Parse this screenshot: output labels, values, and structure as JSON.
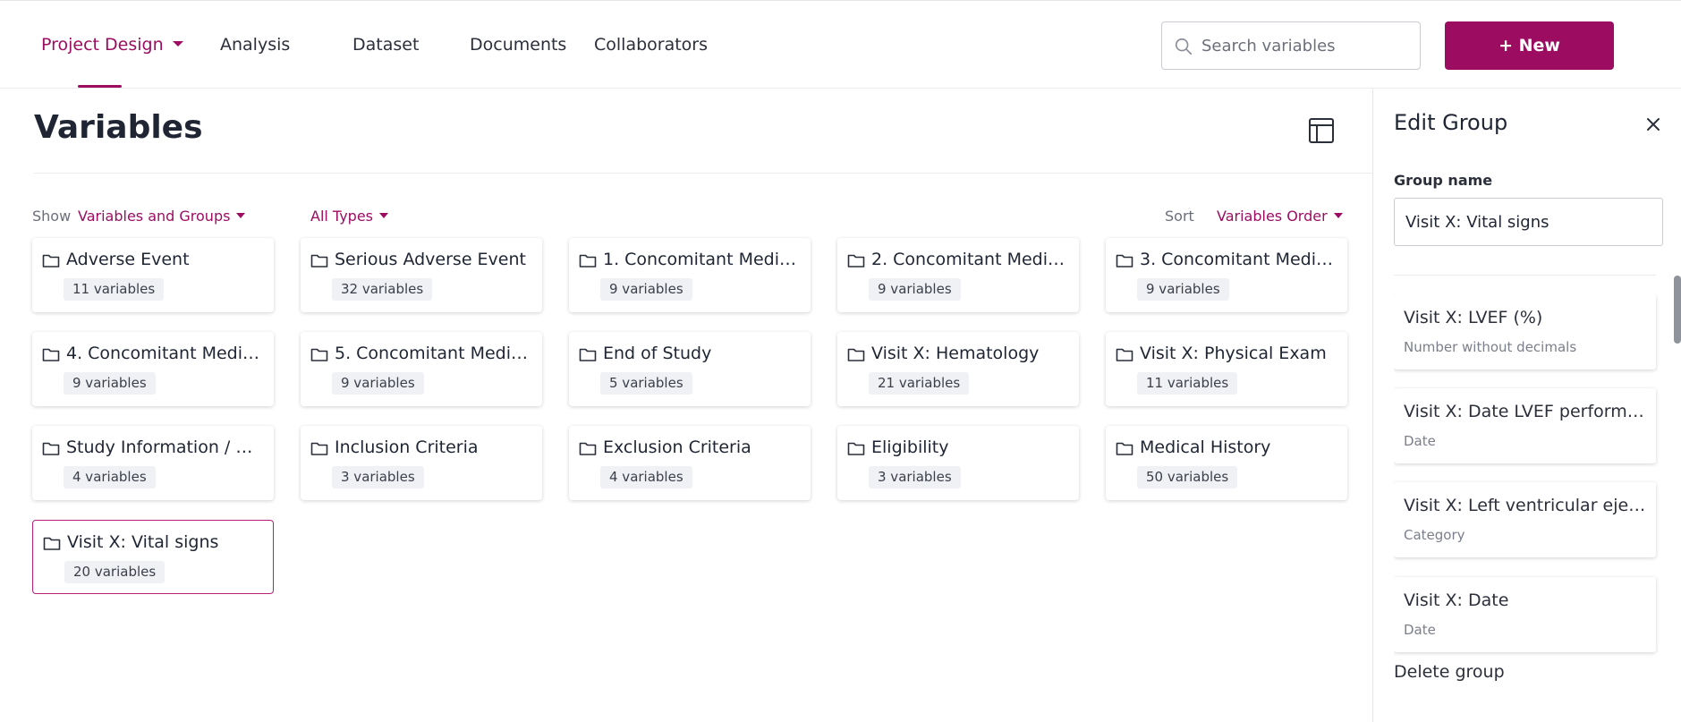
{
  "nav": {
    "items": [
      {
        "label": "Project Design",
        "active": true
      },
      {
        "label": "Analysis"
      },
      {
        "label": "Dataset"
      },
      {
        "label": "Documents"
      },
      {
        "label": "Collaborators"
      }
    ],
    "search_placeholder": "Search variables",
    "new_button": "+ New"
  },
  "main": {
    "title": "Variables",
    "filters": {
      "show_label": "Show",
      "show_value": "Variables and Groups",
      "types_value": "All Types",
      "sort_label": "Sort",
      "sort_value": "Variables Order"
    },
    "groups": [
      {
        "name": "Adverse Event",
        "count": "11 variables"
      },
      {
        "name": "Serious Adverse Event",
        "count": "32 variables"
      },
      {
        "name": "1. Concomitant Medic...",
        "count": "9 variables"
      },
      {
        "name": "2. Concomitant Medic...",
        "count": "9 variables"
      },
      {
        "name": "3. Concomitant Medic...",
        "count": "9 variables"
      },
      {
        "name": "4. Concomitant Medic...",
        "count": "9 variables"
      },
      {
        "name": "5. Concomitant Medic...",
        "count": "9 variables"
      },
      {
        "name": "End of Study",
        "count": "5 variables"
      },
      {
        "name": "Visit X: Hematology",
        "count": "21 variables"
      },
      {
        "name": "Visit X: Physical Exam",
        "count": "11 variables"
      },
      {
        "name": "Study Information / D...",
        "count": "4 variables"
      },
      {
        "name": "Inclusion Criteria",
        "count": "3 variables"
      },
      {
        "name": "Exclusion Criteria",
        "count": "4 variables"
      },
      {
        "name": "Eligibility",
        "count": "3 variables"
      },
      {
        "name": "Medical History",
        "count": "50 variables"
      },
      {
        "name": "Visit X: Vital signs",
        "count": "20 variables",
        "selected": true
      }
    ]
  },
  "panel": {
    "title": "Edit Group",
    "group_name_label": "Group name",
    "group_name_value": "Visit X: Vital signs",
    "variables": [
      {
        "name": "Visit X: LVEF (%)",
        "type": "Number without decimals"
      },
      {
        "name": "Visit X: Date LVEF performed",
        "type": "Date"
      },
      {
        "name": "Visit X: Left ventricular ejecti...",
        "type": "Category"
      },
      {
        "name": "Visit X: Date",
        "type": "Date"
      }
    ],
    "delete_label": "Delete group"
  },
  "colors": {
    "accent": "#9c0d62",
    "text": "#1f2533",
    "muted": "#6b6f7a",
    "badge_bg": "#f0f1f4"
  }
}
